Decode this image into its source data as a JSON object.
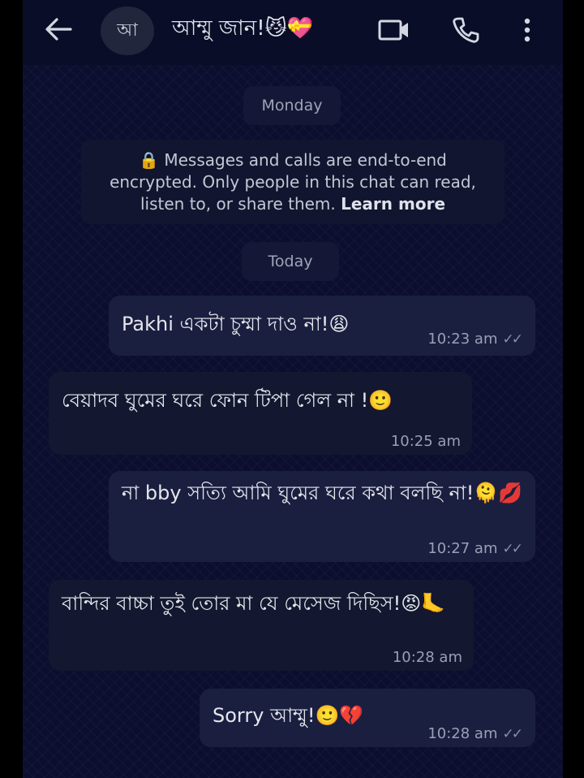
{
  "header": {
    "avatar_initial": "আ",
    "contact_name": "আম্মু জান!😼💝",
    "icons": [
      "back-arrow-icon",
      "video-call-icon",
      "phone-icon",
      "more-vert-icon"
    ]
  },
  "date_separators": [
    "Monday",
    "Today"
  ],
  "encryption_notice": {
    "line1": "🔒 Messages and calls are end-to-end",
    "line2": "encrypted. Only people in this chat can read,",
    "line3": "listen to, or share them.",
    "link": "Learn more"
  },
  "messages": [
    {
      "direction": "outgoing",
      "text": "Pakhi একটা চুম্মা দাও না!😩",
      "time": "10:23 am",
      "ticks": "✓✓"
    },
    {
      "direction": "incoming",
      "text": "বেয়াদব ঘুমের ঘরে ফোন টিপা গেল না !🙂",
      "time": "10:25 am"
    },
    {
      "direction": "outgoing",
      "text": "না bby সত্যি আমি ঘুমের ঘরে কথা বলছি না!🫠💋",
      "time": "10:27 am",
      "ticks": "✓✓"
    },
    {
      "direction": "incoming",
      "text": "বান্দির বাচ্চা তুই তোর মা যে মেসেজ দিছিস!😡🦶",
      "time": "10:28 am"
    },
    {
      "direction": "outgoing",
      "text": "Sorry আম্মু!🙂💔",
      "time": "10:28 am",
      "ticks": "✓✓"
    }
  ],
  "colors": {
    "background": "#0b0e2e",
    "outgoing_bubble": "#1a1f40",
    "incoming_bubble": "#13172f",
    "text": "#e4e6ec",
    "meta": "#9aa0b4"
  }
}
